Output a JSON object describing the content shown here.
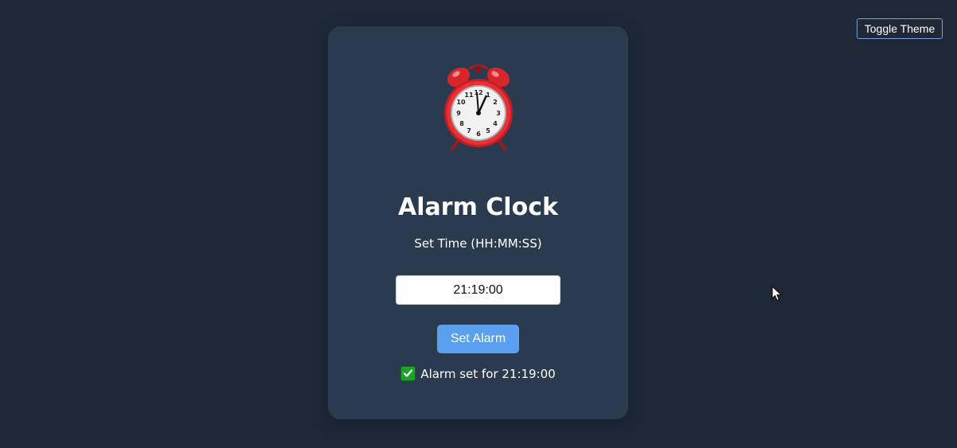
{
  "header": {
    "toggle_theme_label": "Toggle Theme"
  },
  "card": {
    "icon": "alarm-clock-icon",
    "title": "Alarm Clock",
    "subtitle": "Set Time (HH:MM:SS)",
    "time_input_value": "21:19:00",
    "set_button_label": "Set Alarm",
    "status_icon": "check-mark-icon",
    "status_text": "Alarm set for 21:19:00"
  },
  "colors": {
    "background": "#1e2837",
    "card": "#2b3b4f",
    "button": "#5aa0ef",
    "check": "#1fa22a",
    "clock_red": "#d8252a"
  }
}
